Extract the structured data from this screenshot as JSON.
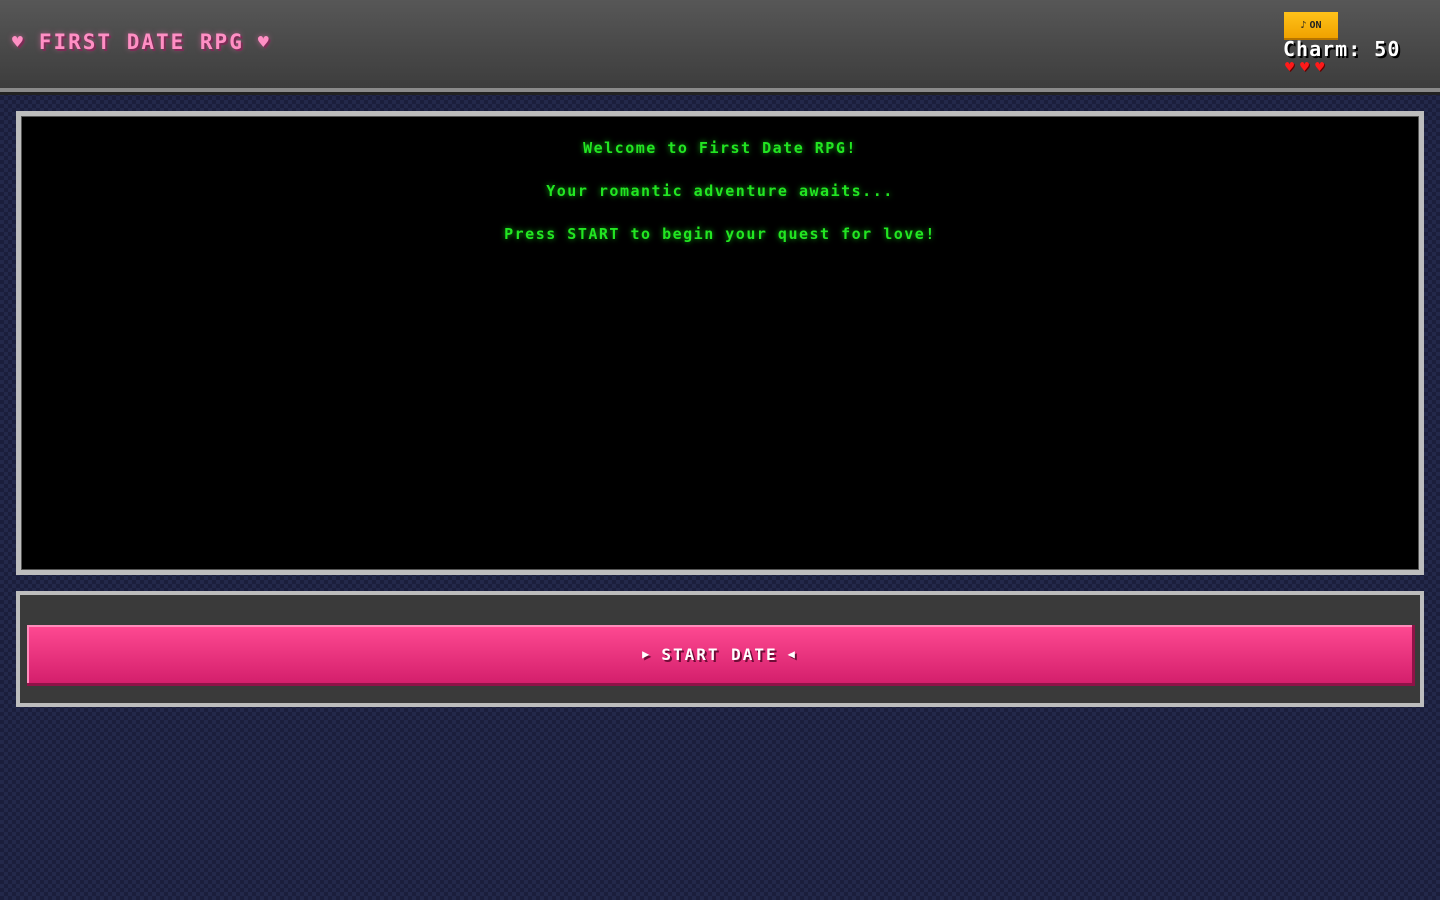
{
  "header": {
    "title": "FIRST DATE RPG",
    "title_icon": "heart-icon",
    "sound": {
      "icon": "♪",
      "label": "ON"
    },
    "charm_label": "Charm:",
    "charm_value": "50",
    "lives": {
      "count": 3,
      "icon": "heart-icon",
      "color": "#ff1a1a"
    }
  },
  "dialogue": {
    "lines": [
      "Welcome to First Date RPG!",
      "Your romantic adventure awaits...",
      "Press START to begin your quest for love!"
    ]
  },
  "actions": {
    "start_label": "START DATE",
    "left_arrow": "▶",
    "right_arrow": "◀"
  },
  "colors": {
    "title_pink": "#ff8fc4",
    "terminal_green": "#22e622",
    "button_pink": "#ff4a92",
    "toggle_yellow": "#ffc21a"
  }
}
